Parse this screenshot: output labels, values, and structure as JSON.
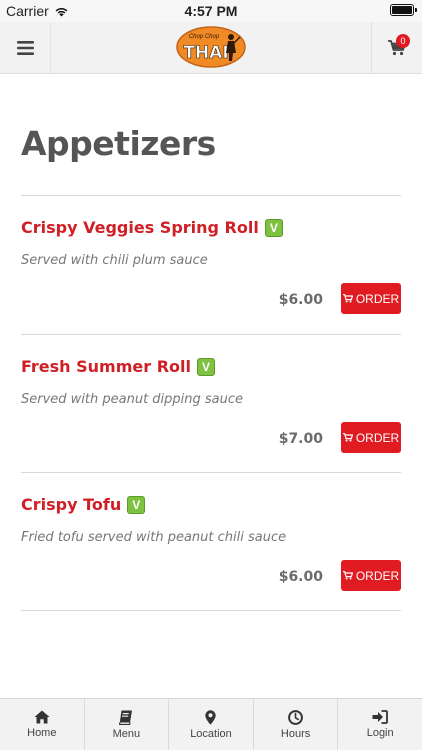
{
  "status_bar": {
    "carrier": "Carrier",
    "time": "4:57 PM"
  },
  "header": {
    "logo_text": "THAI",
    "logo_subtext": "Chop Chop",
    "cart_count": "0",
    "icons": [
      "hamburger-icon",
      "cart-icon"
    ]
  },
  "colors": {
    "accent_red": "#e11b22",
    "item_name_red": "#d01f25",
    "veg_green": "#7fc241",
    "logo_orange": "#f08a24"
  },
  "page": {
    "title": "Appetizers"
  },
  "menu_items": [
    {
      "name": "Crispy Veggies Spring Roll",
      "veg_badge": "V",
      "description": "Served with chili plum sauce",
      "price": "$6.00",
      "order_label": "ORDER"
    },
    {
      "name": "Fresh Summer Roll",
      "veg_badge": "V",
      "description": "Served with peanut dipping sauce",
      "price": "$7.00",
      "order_label": "ORDER"
    },
    {
      "name": "Crispy Tofu",
      "veg_badge": "V",
      "description": "Fried tofu served with peanut chili sauce",
      "price": "$6.00",
      "order_label": "ORDER"
    }
  ],
  "tab_bar": {
    "tabs": [
      {
        "label": "Home",
        "icon": "home-icon"
      },
      {
        "label": "Menu",
        "icon": "book-icon"
      },
      {
        "label": "Location",
        "icon": "map-pin-icon"
      },
      {
        "label": "Hours",
        "icon": "clock-icon"
      },
      {
        "label": "Login",
        "icon": "login-icon"
      }
    ]
  }
}
